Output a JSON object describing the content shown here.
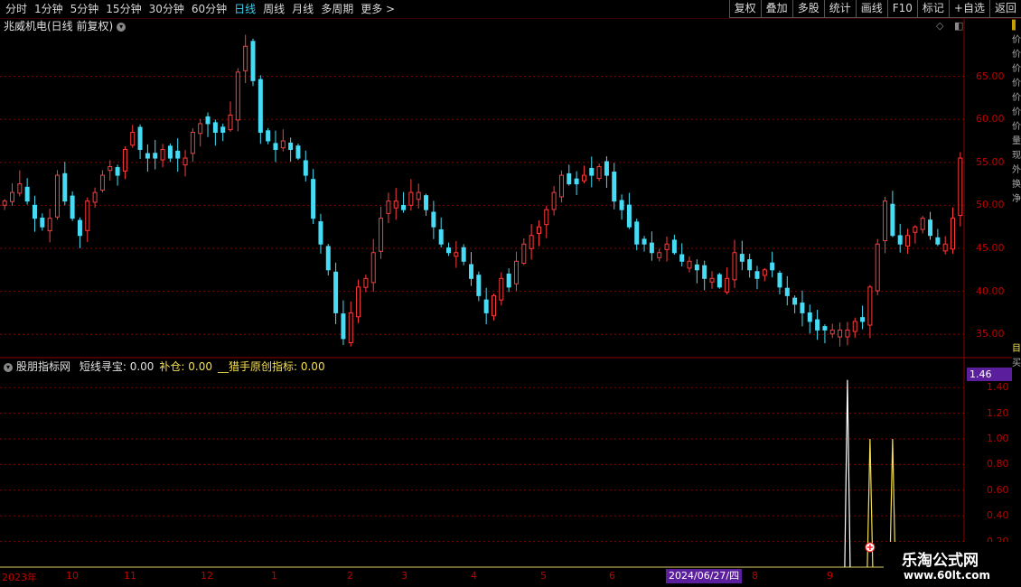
{
  "toolbar": {
    "periods": [
      "分时",
      "1分钟",
      "5分钟",
      "15分钟",
      "30分钟",
      "60分钟",
      "日线",
      "周线",
      "月线",
      "多周期",
      "更多 >"
    ],
    "active": "日线",
    "right_buttons": [
      "复权",
      "叠加",
      "多股",
      "统计",
      "画线",
      "F10",
      "标记",
      "+自选",
      "返回"
    ]
  },
  "main": {
    "title": "兆威机电(日线 前复权)",
    "y_ticks": [
      "65.00",
      "60.00",
      "55.00",
      "50.00",
      "45.00",
      "40.00",
      "35.00"
    ]
  },
  "indicator": {
    "name": "股朋指标网",
    "items": [
      {
        "label": "短线寻宝:",
        "value": "0.00"
      },
      {
        "label": "补仓:",
        "value": "0.00"
      },
      {
        "label": "__猎手原创指标:",
        "value": "0.00"
      }
    ],
    "y_ticks": [
      "1.40",
      "1.20",
      "1.00",
      "0.80",
      "0.60",
      "0.40",
      "0.20"
    ],
    "current_value": "1.46"
  },
  "x_axis": {
    "labels": [
      "2023年",
      "10",
      "11",
      "12",
      "1",
      "2",
      "3",
      "4",
      "5",
      "6",
      "8",
      "9"
    ],
    "selected_date": "2024/06/27/四"
  },
  "watermark": {
    "line1": "乐淘公式网",
    "line2": "www.60lt.com"
  },
  "colors": {
    "up": "#ff3b3b",
    "down": "#46dcf5",
    "grid": "#8a0000",
    "axis": "#c00000",
    "white": "#ffffff",
    "yellow": "#f5e050"
  },
  "chart_data": [
    {
      "type": "candlestick",
      "title": "兆威机电(日线 前复权)",
      "ylim": [
        32.5,
        70.0
      ],
      "x_labels": [
        "2023年",
        "10",
        "11",
        "12",
        "1",
        "2",
        "3",
        "4",
        "5",
        "6",
        "8",
        "9"
      ],
      "closes": [
        50.5,
        51.5,
        52.5,
        50.5,
        48.5,
        47.5,
        48.5,
        53.5,
        50.5,
        48.5,
        46.5,
        50.5,
        51.5,
        53.5,
        54.5,
        53.5,
        56.5,
        58.5,
        56.5,
        55.5,
        55.5,
        56.5,
        55.5,
        55.5,
        55.5,
        58.5,
        59.5,
        59.5,
        58.5,
        58.5,
        60.5,
        65.5,
        68.5,
        64.5,
        58.5,
        57.5,
        56.5,
        57.5,
        56.5,
        55.5,
        53.5,
        48.5,
        45.5,
        42.5,
        37.5,
        34.5,
        37.5,
        40.5,
        41.5,
        44.5,
        48.5,
        50.5,
        50.5,
        49.5,
        51.5,
        51.5,
        49.5,
        47.5,
        45.5,
        44.5,
        44.5,
        43.5,
        41.5,
        39.5,
        37.5,
        39.5,
        41.5,
        40.5,
        43.5,
        45.5,
        46.5,
        47.5,
        49.5,
        51.5,
        53.5,
        52.5,
        52.5,
        53.5,
        53.5,
        54.5,
        53.5,
        50.5,
        49.5,
        47.5,
        45.5,
        45.5,
        44.5,
        44.5,
        45.5,
        44.5,
        43.5,
        43.5,
        42.5,
        41.5,
        41.5,
        40.5,
        41.5,
        44.5,
        43.5,
        42.5,
        41.5,
        42.5,
        42.5,
        40.5,
        39.5,
        38.5,
        37.5,
        36.5,
        35.5,
        35.5,
        35.5,
        35.5,
        35.5,
        36.5,
        36.5,
        40.5,
        45.5,
        50.5,
        46.5,
        45.5,
        46.5,
        47.5,
        48.5,
        46.5,
        45.5,
        45.5,
        48.5,
        55.5
      ],
      "price_ticks": [
        65,
        60,
        55,
        50,
        45,
        40,
        35
      ]
    },
    {
      "type": "line",
      "title": "股朋指标网",
      "ylim": [
        0,
        1.5
      ],
      "series": [
        {
          "name": "短线寻宝",
          "color": "#ffffff",
          "spikes": [
            {
              "day": 112,
              "value": 1.46
            }
          ]
        },
        {
          "name": "补仓",
          "color": "#f5e050",
          "spikes": [
            {
              "day": 115,
              "value": 1.0
            },
            {
              "day": 118,
              "value": 1.0
            }
          ]
        },
        {
          "name": "__猎手原创指标",
          "color": "#f5e050",
          "spikes": []
        }
      ],
      "markers_days": [
        115,
        118
      ],
      "value_ticks": [
        1.4,
        1.2,
        1.0,
        0.8,
        0.6,
        0.4,
        0.2
      ]
    }
  ]
}
